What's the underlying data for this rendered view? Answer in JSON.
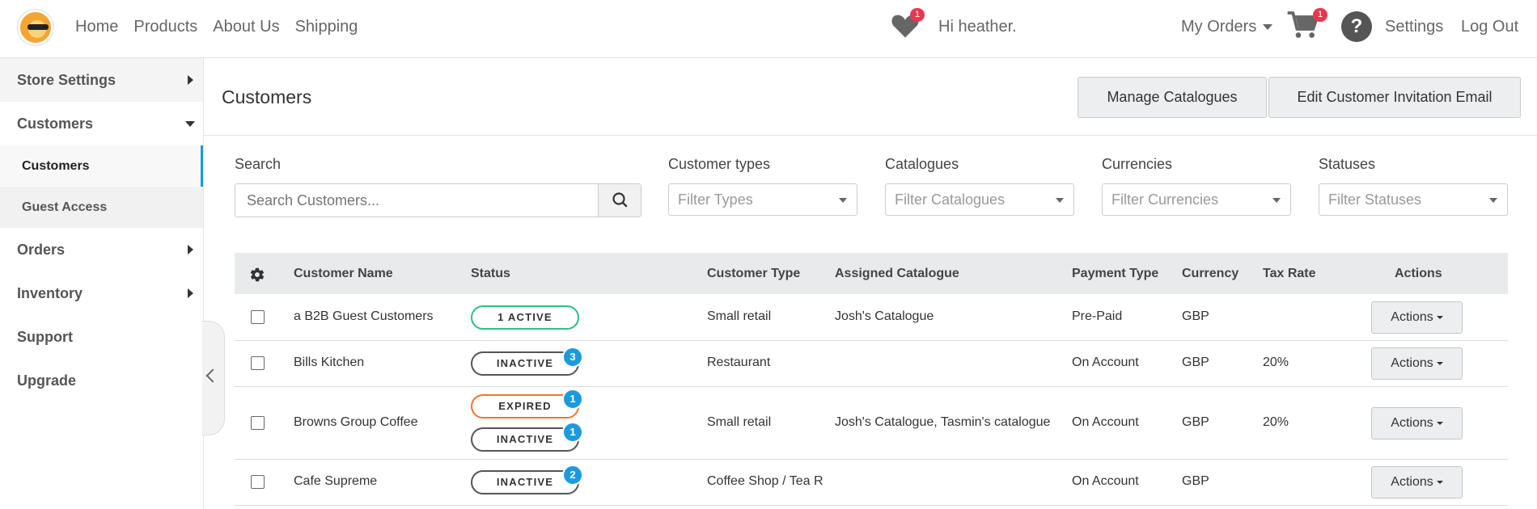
{
  "nav": {
    "links": [
      "Home",
      "Products",
      "About Us",
      "Shipping"
    ],
    "wishlist_count": "1",
    "greeting": "Hi heather.",
    "my_orders": "My Orders",
    "cart_count": "1",
    "help": "?",
    "settings": "Settings",
    "logout": "Log Out"
  },
  "sidebar": {
    "items": [
      {
        "label": "Store Settings"
      },
      {
        "label": "Customers"
      },
      {
        "label": "Customers"
      },
      {
        "label": "Guest Access"
      },
      {
        "label": "Orders"
      },
      {
        "label": "Inventory"
      },
      {
        "label": "Support"
      },
      {
        "label": "Upgrade"
      }
    ]
  },
  "header": {
    "title": "Customers",
    "manage_catalogues": "Manage Catalogues",
    "edit_invitation": "Edit Customer Invitation Email"
  },
  "filters": {
    "search_label": "Search",
    "search_placeholder": "Search Customers...",
    "types_label": "Customer types",
    "types_placeholder": "Filter Types",
    "catalogues_label": "Catalogues",
    "catalogues_placeholder": "Filter Catalogues",
    "currencies_label": "Currencies",
    "currencies_placeholder": "Filter Currencies",
    "statuses_label": "Statuses",
    "statuses_placeholder": "Filter Statuses"
  },
  "table": {
    "headers": [
      "Customer Name",
      "Status",
      "Customer Type",
      "Assigned Catalogue",
      "Payment Type",
      "Currency",
      "Tax Rate",
      "Actions"
    ],
    "rows": [
      {
        "name": "a B2B Guest Customers",
        "status1": "1 ACTIVE",
        "type": "Small retail",
        "catalogue": "Josh's Catalogue",
        "payment": "Pre-Paid",
        "currency": "GBP",
        "tax": "",
        "action": "Actions"
      },
      {
        "name": "Bills Kitchen",
        "status1": "INACTIVE",
        "badge1": "3",
        "type": "Restaurant",
        "catalogue": "",
        "payment": "On Account",
        "currency": "GBP",
        "tax": "20%",
        "action": "Actions"
      },
      {
        "name": "Browns Group Coffee",
        "status1": "EXPIRED",
        "badge1": "1",
        "status2": "INACTIVE",
        "badge2": "1",
        "type": "Small retail",
        "catalogue": "Josh's Catalogue, Tasmin's catalogue",
        "payment": "On Account",
        "currency": "GBP",
        "tax": "20%",
        "action": "Actions"
      },
      {
        "name": "Cafe Supreme",
        "status1": "INACTIVE",
        "badge1": "2",
        "type": "Coffee Shop / Tea R",
        "catalogue": "",
        "payment": "On Account",
        "currency": "GBP",
        "tax": "",
        "action": "Actions"
      }
    ]
  },
  "colors": {
    "accent": "#1a9bdf",
    "active": "#2dbf81",
    "expired": "#ee7630",
    "badge_red": "#e8384f"
  }
}
